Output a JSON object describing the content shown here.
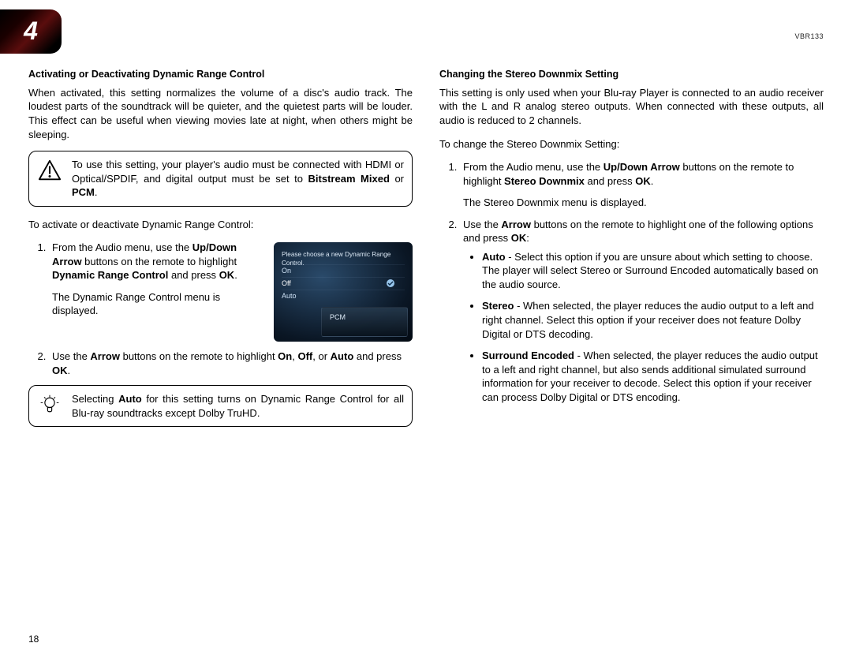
{
  "chapter": "4",
  "model": "VBR133",
  "page_number": "18",
  "left": {
    "heading": "Activating or Deactivating Dynamic Range Control",
    "intro": "When activated, this setting normalizes the volume of a disc's audio track. The loudest parts of the soundtrack will be quieter, and the quietest parts will be louder. This effect can be useful when viewing movies late at night, when others might be sleeping.",
    "warn_pre": "To use this setting, your player's audio must be connected with HDMI or Optical/SPDIF, and digital output must be set to ",
    "warn_b1": "Bitstream Mixed",
    "warn_mid": " or ",
    "warn_b2": "PCM",
    "warn_post": ".",
    "lead": "To activate or deactivate Dynamic Range Control:",
    "step1_a": "From the Audio menu, use the ",
    "step1_b1": "Up/Down Arrow",
    "step1_b": " buttons on the remote to highlight ",
    "step1_b2": "Dynamic Range Control",
    "step1_c": " and press ",
    "step1_b3": "OK",
    "step1_d": ".",
    "step1_result": "The Dynamic Range Control menu is displayed.",
    "step2_a": "Use the ",
    "step2_b1": "Arrow",
    "step2_b": " buttons on the remote to highlight ",
    "step2_b2": "On",
    "step2_c": ", ",
    "step2_b3": "Off",
    "step2_d": ", or ",
    "step2_b4": "Auto",
    "step2_e": " and press ",
    "step2_b5": "OK",
    "step2_f": ".",
    "tip_a": "Selecting ",
    "tip_b1": "Auto",
    "tip_b": " for this setting turns on Dynamic Range Control for all Blu-ray soundtracks except Dolby TruHD.",
    "ss": {
      "title": "Please choose a new Dynamic Range Control.",
      "r1": "On",
      "r2": "Off",
      "r3": "Auto",
      "pcm": "PCM"
    }
  },
  "right": {
    "heading": "Changing the Stereo Downmix Setting",
    "intro": "This setting is only used when your Blu-ray Player is connected to an audio receiver with the L and R analog stereo outputs. When connected with these outputs, all audio is reduced to 2 channels.",
    "lead": "To change the Stereo Downmix Setting:",
    "step1_a": "From the Audio menu, use the ",
    "step1_b1": "Up/Down Arrow",
    "step1_b": " buttons on the remote to highlight ",
    "step1_b2": "Stereo Downmix",
    "step1_c": " and press ",
    "step1_b3": "OK",
    "step1_d": ".",
    "step1_result": "The Stereo Downmix menu is displayed.",
    "step2_a": "Use the ",
    "step2_b1": "Arrow",
    "step2_b": " buttons on the remote to highlight one of the following options and press ",
    "step2_b2": "OK",
    "step2_c": ":",
    "opt1_name": "Auto",
    "opt1_text": " - Select this option if you are unsure about which setting to choose. The player will select Stereo or Surround Encoded automatically based on the audio source.",
    "opt2_name": "Stereo",
    "opt2_text": " - When selected, the player reduces the audio output to a left and right channel. Select this option if your receiver does not feature Dolby Digital or DTS decoding.",
    "opt3_name": "Surround Encoded",
    "opt3_text": " - When selected, the player reduces the audio output to a left and right channel, but also sends additional simulated surround information for your receiver to decode. Select this option if your receiver can process Dolby Digital or DTS encoding."
  }
}
